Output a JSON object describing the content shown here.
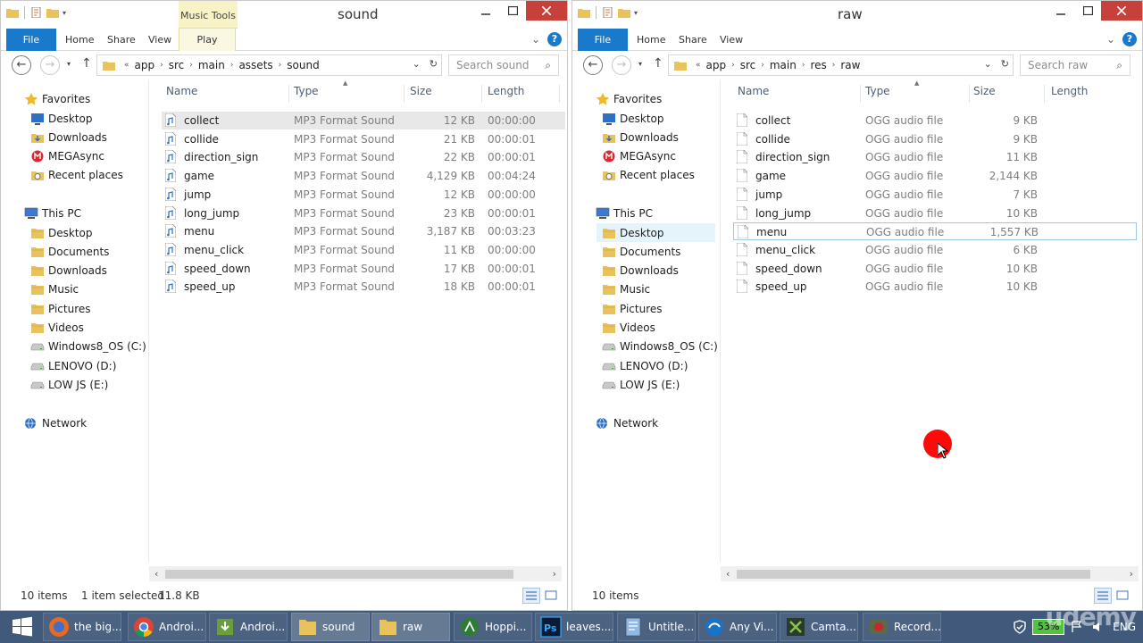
{
  "left": {
    "title": "sound",
    "ctx_tab": "Music Tools",
    "ribbon": {
      "file": "File",
      "home": "Home",
      "share": "Share",
      "view": "View",
      "play": "Play"
    },
    "crumbs": [
      "app",
      "src",
      "main",
      "assets",
      "sound"
    ],
    "crumb_lead": "«",
    "search_placeholder": "Search sound",
    "nav": [
      {
        "label": "Favorites",
        "icon": "star-icon"
      },
      {
        "label": "Desktop",
        "icon": "desktop-icon"
      },
      {
        "label": "Downloads",
        "icon": "downloads-icon"
      },
      {
        "label": "MEGAsync",
        "icon": "mega-icon"
      },
      {
        "label": "Recent places",
        "icon": "recent-icon"
      },
      {
        "label": "This PC",
        "icon": "computer-icon"
      },
      {
        "label": "Desktop",
        "icon": "folder-icon"
      },
      {
        "label": "Documents",
        "icon": "folder-icon"
      },
      {
        "label": "Downloads",
        "icon": "folder-icon"
      },
      {
        "label": "Music",
        "icon": "folder-icon"
      },
      {
        "label": "Pictures",
        "icon": "folder-icon"
      },
      {
        "label": "Videos",
        "icon": "folder-icon"
      },
      {
        "label": "Windows8_OS (C:)",
        "icon": "drive-icon"
      },
      {
        "label": "LENOVO (D:)",
        "icon": "drive-icon"
      },
      {
        "label": "LOW JS (E:)",
        "icon": "drive-icon"
      },
      {
        "label": "Network",
        "icon": "network-icon"
      }
    ],
    "columns": [
      "Name",
      "Type",
      "Size",
      "Length"
    ],
    "files": [
      {
        "name": "collect",
        "type": "MP3 Format Sound",
        "size": "12 KB",
        "length": "00:00:00"
      },
      {
        "name": "collide",
        "type": "MP3 Format Sound",
        "size": "21 KB",
        "length": "00:00:01"
      },
      {
        "name": "direction_sign",
        "type": "MP3 Format Sound",
        "size": "22 KB",
        "length": "00:00:01"
      },
      {
        "name": "game",
        "type": "MP3 Format Sound",
        "size": "4,129 KB",
        "length": "00:04:24"
      },
      {
        "name": "jump",
        "type": "MP3 Format Sound",
        "size": "12 KB",
        "length": "00:00:00"
      },
      {
        "name": "long_jump",
        "type": "MP3 Format Sound",
        "size": "23 KB",
        "length": "00:00:01"
      },
      {
        "name": "menu",
        "type": "MP3 Format Sound",
        "size": "3,187 KB",
        "length": "00:03:23"
      },
      {
        "name": "menu_click",
        "type": "MP3 Format Sound",
        "size": "11 KB",
        "length": "00:00:00"
      },
      {
        "name": "speed_down",
        "type": "MP3 Format Sound",
        "size": "17 KB",
        "length": "00:00:01"
      },
      {
        "name": "speed_up",
        "type": "MP3 Format Sound",
        "size": "18 KB",
        "length": "00:00:01"
      }
    ],
    "status_count": "10 items",
    "status_selected": "1 item selected",
    "status_size": "11.8 KB"
  },
  "right": {
    "title": "raw",
    "ribbon": {
      "file": "File",
      "home": "Home",
      "share": "Share",
      "view": "View"
    },
    "crumbs": [
      "app",
      "src",
      "main",
      "res",
      "raw"
    ],
    "crumb_lead": "«",
    "search_placeholder": "Search raw",
    "nav": [
      {
        "label": "Favorites",
        "icon": "star-icon"
      },
      {
        "label": "Desktop",
        "icon": "desktop-icon"
      },
      {
        "label": "Downloads",
        "icon": "downloads-icon"
      },
      {
        "label": "MEGAsync",
        "icon": "mega-icon"
      },
      {
        "label": "Recent places",
        "icon": "recent-icon"
      },
      {
        "label": "This PC",
        "icon": "computer-icon"
      },
      {
        "label": "Desktop",
        "icon": "folder-icon"
      },
      {
        "label": "Documents",
        "icon": "folder-icon"
      },
      {
        "label": "Downloads",
        "icon": "folder-icon"
      },
      {
        "label": "Music",
        "icon": "folder-icon"
      },
      {
        "label": "Pictures",
        "icon": "folder-icon"
      },
      {
        "label": "Videos",
        "icon": "folder-icon"
      },
      {
        "label": "Windows8_OS (C:)",
        "icon": "drive-icon"
      },
      {
        "label": "LENOVO (D:)",
        "icon": "drive-icon"
      },
      {
        "label": "LOW JS (E:)",
        "icon": "drive-icon"
      },
      {
        "label": "Network",
        "icon": "network-icon"
      }
    ],
    "columns": [
      "Name",
      "Type",
      "Size",
      "Length"
    ],
    "files": [
      {
        "name": "collect",
        "type": "OGG audio file",
        "size": "9 KB"
      },
      {
        "name": "collide",
        "type": "OGG audio file",
        "size": "9 KB"
      },
      {
        "name": "direction_sign",
        "type": "OGG audio file",
        "size": "11 KB"
      },
      {
        "name": "game",
        "type": "OGG audio file",
        "size": "2,144 KB"
      },
      {
        "name": "jump",
        "type": "OGG audio file",
        "size": "7 KB"
      },
      {
        "name": "long_jump",
        "type": "OGG audio file",
        "size": "10 KB"
      },
      {
        "name": "menu",
        "type": "OGG audio file",
        "size": "1,557 KB"
      },
      {
        "name": "menu_click",
        "type": "OGG audio file",
        "size": "6 KB"
      },
      {
        "name": "speed_down",
        "type": "OGG audio file",
        "size": "10 KB"
      },
      {
        "name": "speed_up",
        "type": "OGG audio file",
        "size": "10 KB"
      }
    ],
    "status_count": "10 items"
  },
  "taskbar": {
    "items": [
      {
        "label": "the big...",
        "icon": "firefox-icon"
      },
      {
        "label": "Androi...",
        "icon": "chrome-icon"
      },
      {
        "label": "Androi...",
        "icon": "installer-icon"
      },
      {
        "label": "sound",
        "icon": "folder-icon"
      },
      {
        "label": "raw",
        "icon": "folder-icon"
      },
      {
        "label": "Hoppi...",
        "icon": "android-studio-icon"
      },
      {
        "label": "leaves....",
        "icon": "photoshop-icon"
      },
      {
        "label": "Untitle...",
        "icon": "notepad-icon"
      },
      {
        "label": "Any Vi...",
        "icon": "video-converter-icon"
      },
      {
        "label": "Camta...",
        "icon": "camtasia-icon"
      },
      {
        "label": "Record...",
        "icon": "recorder-icon"
      }
    ],
    "battery": "53%",
    "language": "ENG",
    "watermark": "udemy"
  },
  "colors": {
    "accent": "#1979ca",
    "selection": "#cde8f9",
    "taskbar": "#41597a",
    "close": "#c7413a",
    "cursor": "#ff0a0a"
  }
}
